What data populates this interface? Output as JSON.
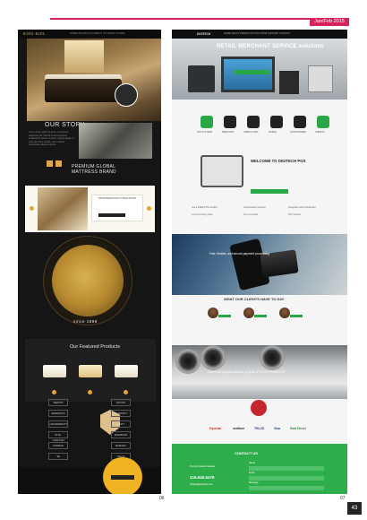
{
  "header": {
    "issue": "Jan/Feb 2015"
  },
  "left_page": {
    "logo": "KING KOIL",
    "nav_links": "HOME  PRODUCTS  ABOUT US  NEWS  STORE",
    "our_story_title": "OUR STORY",
    "story_text": "Lorem ipsum dolor sit amet, consectetur adipiscing elit. Sed do eiusmod tempor incididunt ut labore et dolore magna aliqua. Ut enim ad minim veniam, quis nostrud exercitation ullamco laboris.",
    "brand_line1": "PREMIUM GLOBAL",
    "brand_line2": "MATTRESS BRAND",
    "quote_title": "FROM BED ROOM TO BALLROOM",
    "since": "since 1898",
    "featured_title": "Our Featured Products",
    "brands": [
      "WESTIN",
      "HILTON",
      "SHERATON",
      "MARRIOTT",
      "J.W.MARRIOTT",
      "HYATT",
      "RITZ-CARLTON",
      "RADISSON",
      "CONRAD",
      "RAMADA",
      "Taj",
      "Oberoi"
    ],
    "page_number": "06"
  },
  "right_page": {
    "logo": "DIGITECH",
    "nav_links": "HOME  ABOUT  PRODUCTS  SOLUTIONS  SUPPORT  CONTACT",
    "hero_banner": "RETAIL MERCHANT SERVICE solutions",
    "hero_button": "GET A FREE QUOTE TODAY",
    "icon_labels": [
      "POS SYSTEMS",
      "MERCHANT",
      "CREDIT CARD",
      "MOBILE",
      "CASH DRAWER",
      "TABLETS"
    ],
    "welcome_title": "WELCOME TO DIGITECH POS",
    "welcome_button": "GET A QUOTE",
    "features": [
      "Get a FREE POS solution",
      "Cloud-based reporting",
      "Integration with Quickbooks",
      "Low processing rates",
      "Free terminals",
      "24/7 support"
    ],
    "phone_caption": "Fast, flexible, and secure payment processing",
    "clients_title": "WHAT OUR CLIENTS HAVE TO SAY",
    "machine_caption": "One of the largest selection of QUALITY POS PRODUCTS",
    "partners": [
      "Hyundai",
      "verifone",
      "TELUS",
      "Visa",
      "Deal Direct"
    ],
    "contact_title": "CONTACT US",
    "contact_address": "Toronto Ontario Canada",
    "contact_phone": "416.640.5476",
    "contact_email": "info@digitechpos.com",
    "form_labels": [
      "Name",
      "Email",
      "Message"
    ],
    "page_number": "07",
    "magazine_page": "43"
  },
  "colors": {
    "accent": "#d6245a",
    "gold": "#e0a64a",
    "green": "#2eae4a"
  }
}
